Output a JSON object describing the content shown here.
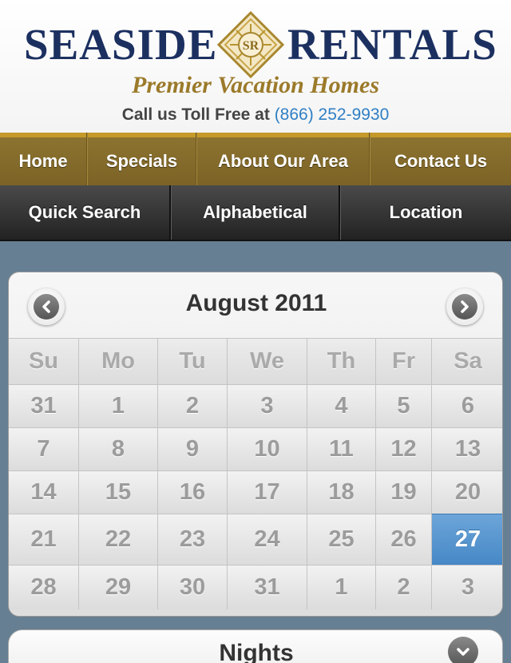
{
  "brand": {
    "name_left": "SEASIDE",
    "name_right": "RENTALS",
    "emblem_text": "SR",
    "tagline": "Premier Vacation Homes",
    "phone_prefix": "Call us Toll Free at",
    "phone": "(866) 252-9930",
    "colors": {
      "navy": "#1c3060",
      "gold": "#9b7a2a",
      "link": "#2f7fc4"
    }
  },
  "primary_nav": [
    {
      "label": "Home"
    },
    {
      "label": "Specials"
    },
    {
      "label": "About Our Area"
    },
    {
      "label": "Contact Us"
    }
  ],
  "search_tabs": [
    {
      "label": "Quick Search"
    },
    {
      "label": "Alphabetical"
    },
    {
      "label": "Location"
    }
  ],
  "calendar": {
    "title": "August 2011",
    "prev_icon": "chevron-left-icon",
    "next_icon": "chevron-right-icon",
    "weekdays": [
      "Su",
      "Mo",
      "Tu",
      "We",
      "Th",
      "Fr",
      "Sa"
    ],
    "weeks": [
      [
        "31",
        "1",
        "2",
        "3",
        "4",
        "5",
        "6"
      ],
      [
        "7",
        "8",
        "9",
        "10",
        "11",
        "12",
        "13"
      ],
      [
        "14",
        "15",
        "16",
        "17",
        "18",
        "19",
        "20"
      ],
      [
        "21",
        "22",
        "23",
        "24",
        "25",
        "26",
        "27"
      ],
      [
        "28",
        "29",
        "30",
        "31",
        "1",
        "2",
        "3"
      ]
    ],
    "selected_date": "27",
    "selected_color": "#4f8fcb"
  },
  "nights": {
    "label": "Nights",
    "icon": "chevron-down-icon"
  }
}
